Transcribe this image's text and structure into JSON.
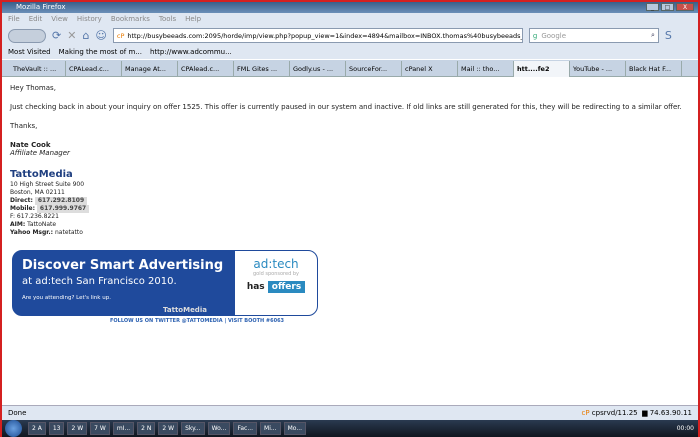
{
  "window": {
    "title": "Mozilla Firefox",
    "controls": [
      "_",
      "□",
      "X"
    ]
  },
  "menu": [
    "File",
    "Edit",
    "View",
    "History",
    "Bookmarks",
    "Tools",
    "Help"
  ],
  "nav": {
    "url": "http://busybeeads.com:2095/horde/imp/view.php?popup_view=1&index=4894&mailbox=INBOX.thomas%40busybeeads_cc",
    "search_placeholder": "Google"
  },
  "bookmarks": [
    "Most Visited",
    "Making the most of m...",
    "http://www.adcommu..."
  ],
  "tabs": [
    "TheVault :: ...",
    "CPALead.c...",
    "Manage At...",
    "CPAlead.c...",
    "FML Gites ...",
    "Godly.us - ...",
    "SourceFor...",
    "cPanel X",
    "Mail :: tho...",
    "htt....fe2",
    "YouTube - ...",
    "Black Hat F..."
  ],
  "email": {
    "greeting": "Hey Thomas,",
    "body": "Just checking back in about your inquiry on offer 1525. This offer is currently paused in our system and inactive. If old links are still generated for this, they will be redirecting to a similar offer.",
    "closing": "Thanks,",
    "name": "Nate Cook",
    "title": "Affiliate Manager",
    "company": "TattoMedia",
    "address1": "10 High Street Suite 900",
    "address2": "Boston, MA 02111",
    "direct_label": "Direct:",
    "direct": "617.292.8109",
    "mobile_label": "Mobile:",
    "mobile": "617.999.9767",
    "fax": "F: 617.236.8221",
    "aim_label": "AIM:",
    "aim": "TattoNate",
    "yahoo_label": "Yahoo Msgr.:",
    "yahoo": "natetatto"
  },
  "banner": {
    "headline": "Discover Smart Advertising",
    "sub": "at ad:tech San Francisco 2010.",
    "small": "Are you attending? Let's link up.",
    "brand": "TattoMedia",
    "adtech": "ad:tech",
    "gold": "gold sponsored by",
    "has": "has",
    "offers": "offers",
    "follow": "FOLLOW US ON TWITTER @TATTOMEDIA  |  VISIT BOOTH #6063"
  },
  "status": {
    "text": "Done",
    "server": "cpsrvd/11.25",
    "ip": "74.63.90.11"
  },
  "taskbar": [
    "2 A",
    "13",
    "2 W",
    "7 W",
    "mI...",
    "2 N",
    "2 W",
    "Sky...",
    "Wo...",
    "Fac...",
    "Mi...",
    "Mo..."
  ],
  "clock": "00:00"
}
